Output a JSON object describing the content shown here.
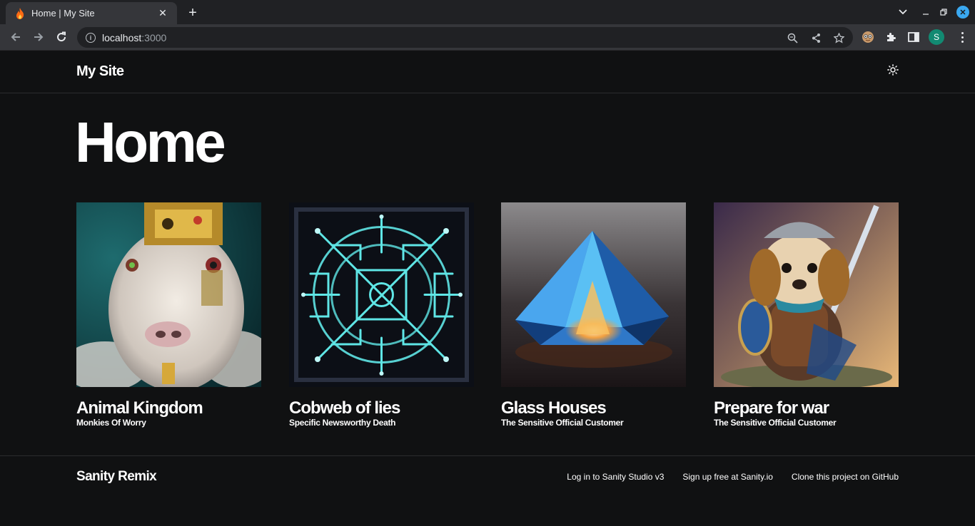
{
  "browser": {
    "tab_title": "Home | My Site",
    "tab_favicon": "fire-icon",
    "url_host": "localhost",
    "url_port": ":3000",
    "profile_initial": "S"
  },
  "header": {
    "site_title": "My Site",
    "theme_icon": "sun-icon"
  },
  "main": {
    "heading": "Home",
    "cards": [
      {
        "title": "Animal Kingdom",
        "subtitle": "Monkies Of Worry",
        "image": "white-ram-with-crown"
      },
      {
        "title": "Cobweb of lies",
        "subtitle": "Specific Newsworthy Death",
        "image": "glowing-circuit-maze"
      },
      {
        "title": "Glass Houses",
        "subtitle": "The Sensitive Official Customer",
        "image": "blue-crystal-pyramid"
      },
      {
        "title": "Prepare for war",
        "subtitle": "The Sensitive Official Customer",
        "image": "armored-puppy-with-sword"
      }
    ]
  },
  "footer": {
    "title": "Sanity Remix",
    "links": [
      "Log in to Sanity Studio v3",
      "Sign up free at Sanity.io",
      "Clone this project on GitHub"
    ]
  },
  "colors": {
    "background": "#101112",
    "text": "#ffffff",
    "divider": "#2b2c2e"
  }
}
